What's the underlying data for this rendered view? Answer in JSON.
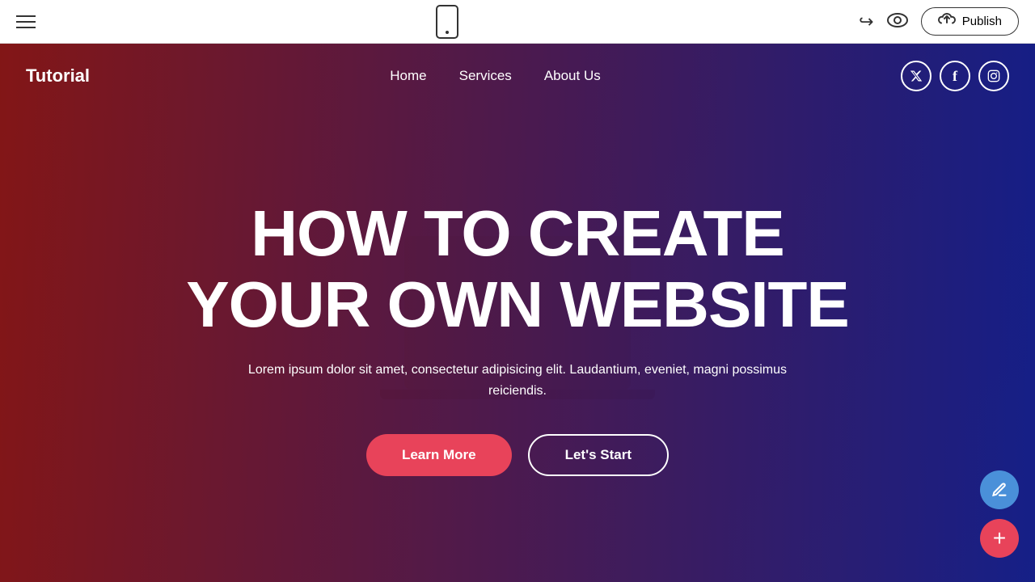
{
  "toolbar": {
    "hamburger_label": "menu",
    "undo_symbol": "↩",
    "eye_symbol": "👁",
    "publish_label": "Publish",
    "cloud_symbol": "☁"
  },
  "site": {
    "logo": "Tutorial",
    "nav": {
      "links": [
        {
          "label": "Home"
        },
        {
          "label": "Services"
        },
        {
          "label": "About Us"
        }
      ]
    },
    "social": {
      "twitter": "𝕏",
      "facebook": "f",
      "instagram": "📷"
    }
  },
  "hero": {
    "title_line1": "HOW TO CREATE",
    "title_line2": "YOUR OWN WEBSITE",
    "subtitle": "Lorem ipsum dolor sit amet, consectetur adipisicing elit. Laudantium, eveniet, magni possimus reiciendis.",
    "btn_learn_more": "Learn More",
    "btn_lets_start": "Let's Start"
  },
  "fab": {
    "edit_icon": "✏",
    "add_icon": "+"
  }
}
